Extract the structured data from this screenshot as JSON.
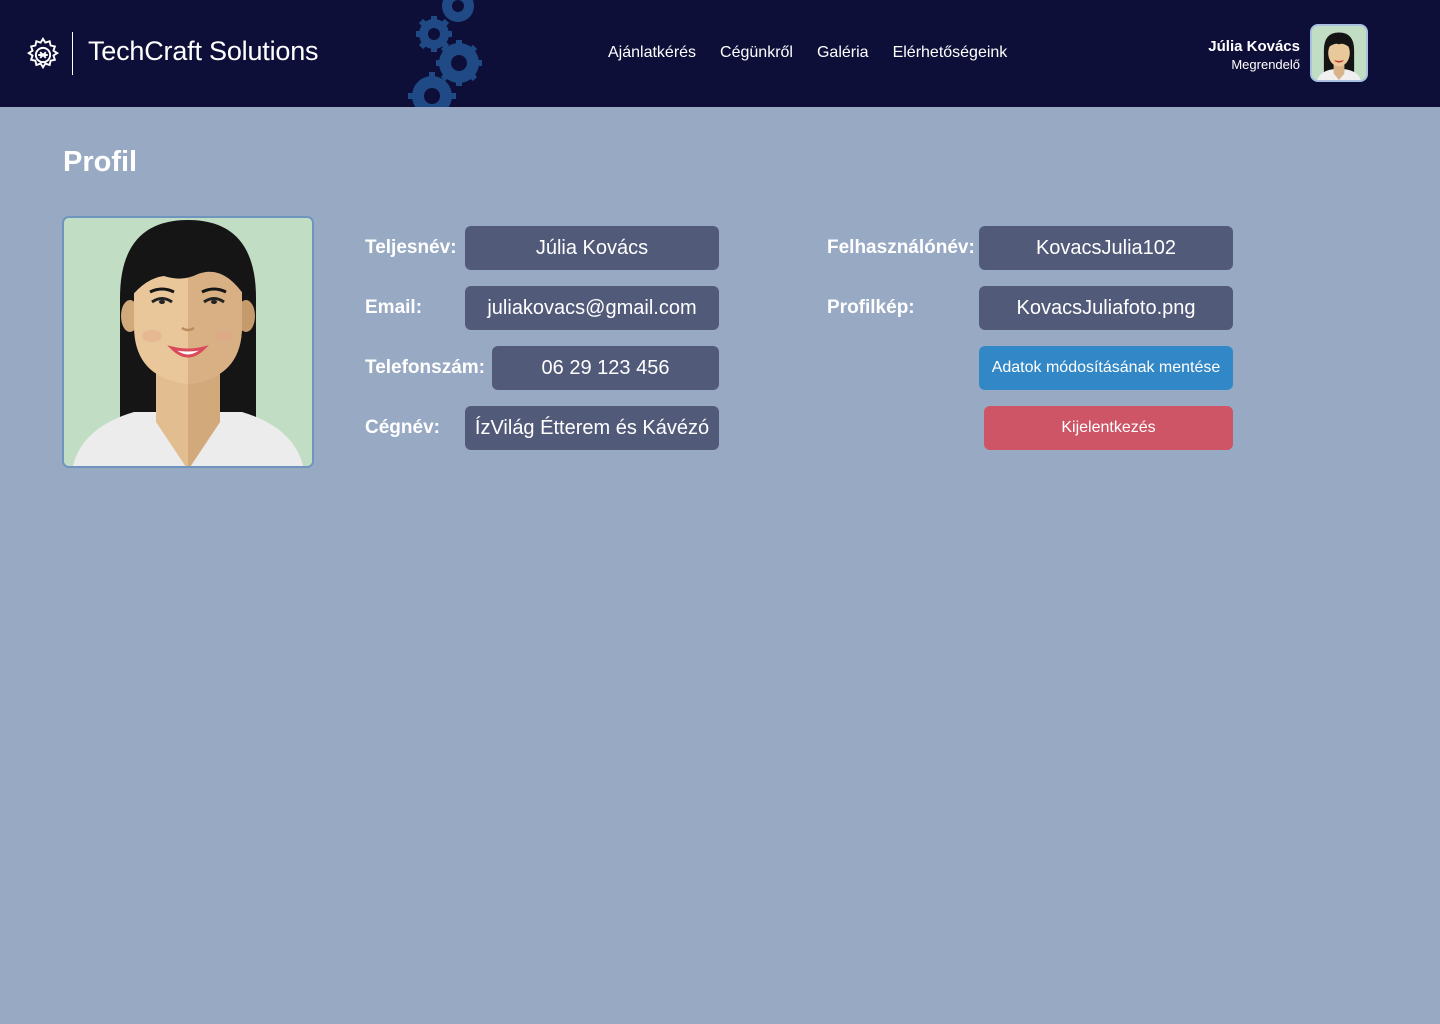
{
  "header": {
    "brand": "TechCraft Solutions",
    "logo_icon": "gear-logo-icon",
    "nav": [
      "Ajánlatkérés",
      "Cégünkről",
      "Galéria",
      "Elérhetőségeink"
    ],
    "user": {
      "name": "Júlia Kovács",
      "role": "Megrendelő"
    }
  },
  "profile": {
    "title": "Profil",
    "fields": {
      "fullname": {
        "label": "Teljesnév:",
        "value": "Júlia Kovács"
      },
      "email": {
        "label": "Email:",
        "value": "juliakovacs@gmail.com"
      },
      "phone": {
        "label": "Telefonszám:",
        "value": "06 29 123 456"
      },
      "company": {
        "label": "Cégnév:",
        "value": "ÍzVilág Étterem és Kávézó"
      },
      "username": {
        "label": "Felhasználónév:",
        "value": "KovacsJulia102"
      },
      "picture": {
        "label": "Profilkép:",
        "value": "KovacsJuliafoto.png"
      }
    },
    "save_button": "Adatok módosításának mentése",
    "logout_button": "Kijelentkezés"
  },
  "colors": {
    "header_bg": "#0d0f38",
    "page_bg": "#98a9c3",
    "field_bg": "#525a7a",
    "save": "#3287c6",
    "logout": "#cd5566"
  }
}
